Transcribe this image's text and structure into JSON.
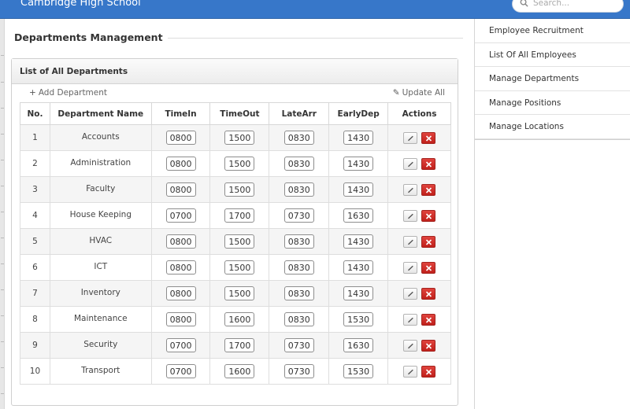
{
  "header": {
    "brand": "Cambridge High School",
    "search_placeholder": "Search..."
  },
  "page": {
    "title": "Departments Management"
  },
  "panel": {
    "title": "List of All Departments",
    "add_label": "Add Department",
    "update_label": "Update All",
    "columns": [
      "No.",
      "Department Name",
      "TimeIn",
      "TimeOut",
      "LateArr",
      "EarlyDep",
      "Actions"
    ]
  },
  "departments": [
    {
      "no": "1",
      "name": "Accounts",
      "time_in": "0800",
      "time_out": "1500",
      "late_arr": "0830",
      "early_dep": "1430"
    },
    {
      "no": "2",
      "name": "Administration",
      "time_in": "0800",
      "time_out": "1500",
      "late_arr": "0830",
      "early_dep": "1430"
    },
    {
      "no": "3",
      "name": "Faculty",
      "time_in": "0800",
      "time_out": "1500",
      "late_arr": "0830",
      "early_dep": "1430"
    },
    {
      "no": "4",
      "name": "House Keeping",
      "time_in": "0700",
      "time_out": "1700",
      "late_arr": "0730",
      "early_dep": "1630"
    },
    {
      "no": "5",
      "name": "HVAC",
      "time_in": "0800",
      "time_out": "1500",
      "late_arr": "0830",
      "early_dep": "1430"
    },
    {
      "no": "6",
      "name": "ICT",
      "time_in": "0800",
      "time_out": "1500",
      "late_arr": "0830",
      "early_dep": "1430"
    },
    {
      "no": "7",
      "name": "Inventory",
      "time_in": "0800",
      "time_out": "1500",
      "late_arr": "0830",
      "early_dep": "1430"
    },
    {
      "no": "8",
      "name": "Maintenance",
      "time_in": "0800",
      "time_out": "1600",
      "late_arr": "0830",
      "early_dep": "1530"
    },
    {
      "no": "9",
      "name": "Security",
      "time_in": "0700",
      "time_out": "1700",
      "late_arr": "0730",
      "early_dep": "1630"
    },
    {
      "no": "10",
      "name": "Transport",
      "time_in": "0700",
      "time_out": "1600",
      "late_arr": "0730",
      "early_dep": "1530"
    }
  ],
  "sidebar": {
    "items": [
      {
        "label": "Employee Recruitment"
      },
      {
        "label": "List Of All Employees"
      },
      {
        "label": "Manage Departments"
      },
      {
        "label": "Manage Positions"
      },
      {
        "label": "Manage Locations"
      }
    ]
  },
  "icons": {
    "search": "search-icon",
    "add": "plus-icon",
    "update": "pencil-icon",
    "edit": "pencil-icon",
    "delete": "close-icon"
  },
  "colors": {
    "topbar": "#3777c9",
    "delete_button": "#d3302a"
  }
}
